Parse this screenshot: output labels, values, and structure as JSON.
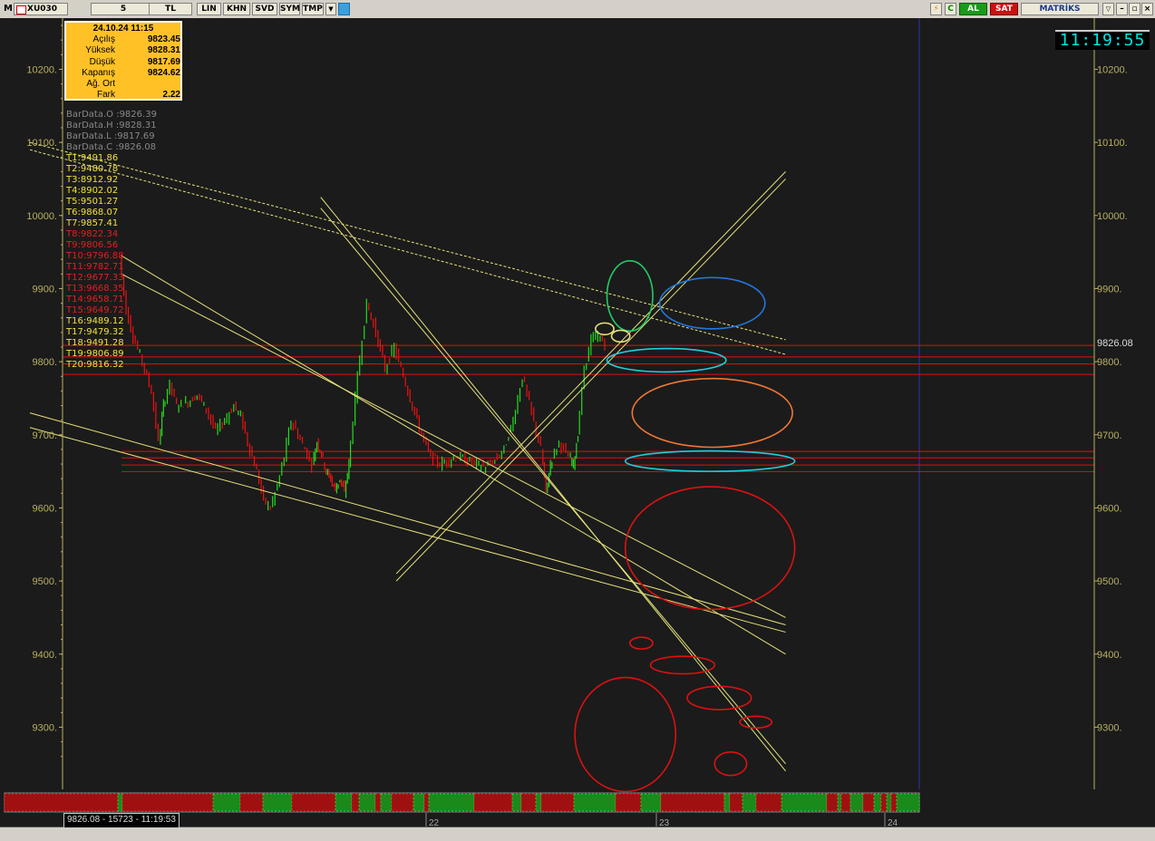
{
  "toolbar": {
    "logo": "M",
    "symbol": "XU030",
    "period": "5",
    "currency": "TL",
    "buttons": [
      "LIN",
      "KHN",
      "SVD",
      "SYM",
      "TMP"
    ],
    "buy_label": "AL",
    "sell_label": "SAT",
    "brand": "MATRİKS"
  },
  "info_box": {
    "datetime": "24.10.24 11:15",
    "rows": [
      {
        "label": "Açılış",
        "value": "9823.45"
      },
      {
        "label": "Yüksek",
        "value": "9828.31"
      },
      {
        "label": "Düşük",
        "value": "9817.69"
      },
      {
        "label": "Kapanış",
        "value": "9824.62"
      },
      {
        "label": "Ağ. Ort",
        "value": ""
      },
      {
        "label": "Fark",
        "value": "2.22"
      }
    ]
  },
  "clock": "11:19:55",
  "bar_data": [
    "BarData.O :9826.39",
    "BarData.H :9828.31",
    "BarData.L :9817.69",
    "BarData.C :9826.08"
  ],
  "t_levels": [
    {
      "text": "T1:9491.86",
      "color": "yellow"
    },
    {
      "text": "T2:9480.78",
      "color": "yellow"
    },
    {
      "text": "T3:8912.92",
      "color": "yellow"
    },
    {
      "text": "T4:8902.02",
      "color": "yellow"
    },
    {
      "text": "T5:9501.27",
      "color": "yellow"
    },
    {
      "text": "T6:9868.07",
      "color": "yellow"
    },
    {
      "text": "T7:9857.41",
      "color": "yellow"
    },
    {
      "text": "T8:9822.34",
      "color": "red"
    },
    {
      "text": "T9:9806.56",
      "color": "red"
    },
    {
      "text": "T10:9796.88",
      "color": "red"
    },
    {
      "text": "T11:9782.71",
      "color": "red"
    },
    {
      "text": "T12:9677.33",
      "color": "red"
    },
    {
      "text": "T13:9668.35",
      "color": "red"
    },
    {
      "text": "T14:9658.71",
      "color": "red"
    },
    {
      "text": "T15:9649.72",
      "color": "red"
    },
    {
      "text": "T16:9489.12",
      "color": "yellow"
    },
    {
      "text": "T17:9479.32",
      "color": "yellow"
    },
    {
      "text": "T18:9491.28",
      "color": "yellow"
    },
    {
      "text": "T19:9806.89",
      "color": "yellow"
    },
    {
      "text": "T20:9816.32",
      "color": "yellow"
    }
  ],
  "status_text": "9826.08 - 15723 - 11:19:53",
  "colors": {
    "up": "#22dd22",
    "down": "#ee1111",
    "trend": "#e6e27a",
    "level": "#e01010",
    "axis": "#b8b060",
    "bg": "#1b1b1b"
  },
  "chart_data": {
    "type": "candlestick",
    "symbol": "XU030",
    "interval": "5",
    "y_ticks": [
      "10200.",
      "10100.",
      "10000.",
      "9900.",
      "9800.",
      "9700.",
      "9600.",
      "9500.",
      "9400.",
      "9300."
    ],
    "ylim": [
      9215,
      10270
    ],
    "x_ticks": [
      "22",
      "23",
      "24"
    ],
    "last_price_label": "9826.08",
    "horizontal_levels": [
      9822.34,
      9806.56,
      9796.88,
      9782.71,
      9677.33,
      9668.35,
      9658.71,
      9649.72
    ],
    "price_path": [
      [
        0,
        9945
      ],
      [
        0.03,
        9870
      ],
      [
        0.06,
        9835
      ],
      [
        0.1,
        9800
      ],
      [
        0.14,
        9760
      ],
      [
        0.17,
        9690
      ],
      [
        0.19,
        9740
      ],
      [
        0.22,
        9770
      ],
      [
        0.25,
        9740
      ],
      [
        0.3,
        9745
      ],
      [
        0.34,
        9755
      ],
      [
        0.38,
        9735
      ],
      [
        0.42,
        9705
      ],
      [
        0.46,
        9720
      ],
      [
        0.5,
        9740
      ],
      [
        0.53,
        9725
      ],
      [
        0.56,
        9690
      ],
      [
        0.6,
        9650
      ],
      [
        0.63,
        9610
      ],
      [
        0.66,
        9600
      ],
      [
        0.69,
        9630
      ],
      [
        0.72,
        9670
      ],
      [
        0.75,
        9720
      ],
      [
        0.78,
        9700
      ],
      [
        0.81,
        9680
      ],
      [
        0.84,
        9660
      ],
      [
        0.86,
        9690
      ],
      [
        0.88,
        9675
      ],
      [
        0.9,
        9650
      ],
      [
        0.92,
        9640
      ],
      [
        0.94,
        9625
      ],
      [
        0.96,
        9640
      ],
      [
        0.98,
        9620
      ],
      [
        1.0,
        9660
      ],
      [
        1.04,
        9780
      ],
      [
        1.08,
        9880
      ],
      [
        1.12,
        9840
      ],
      [
        1.16,
        9790
      ],
      [
        1.2,
        9820
      ],
      [
        1.24,
        9780
      ],
      [
        1.28,
        9740
      ],
      [
        1.32,
        9700
      ],
      [
        1.36,
        9670
      ],
      [
        1.4,
        9660
      ],
      [
        1.44,
        9665
      ],
      [
        1.48,
        9670
      ],
      [
        1.52,
        9665
      ],
      [
        1.56,
        9660
      ],
      [
        1.6,
        9655
      ],
      [
        1.64,
        9665
      ],
      [
        1.68,
        9680
      ],
      [
        1.72,
        9720
      ],
      [
        1.76,
        9780
      ],
      [
        1.8,
        9730
      ],
      [
        1.84,
        9680
      ],
      [
        1.86,
        9620
      ],
      [
        1.88,
        9660
      ],
      [
        1.92,
        9690
      ],
      [
        1.96,
        9670
      ],
      [
        1.98,
        9660
      ],
      [
        2.0,
        9700
      ],
      [
        2.03,
        9790
      ],
      [
        2.06,
        9830
      ],
      [
        2.09,
        9835
      ],
      [
        2.12,
        9826
      ]
    ],
    "trend_lines": [
      [
        [
          0,
          9945
        ],
        [
          2.9,
          9400
        ]
      ],
      [
        [
          0,
          9920
        ],
        [
          2.9,
          9450
        ]
      ],
      [
        [
          -0.4,
          9730
        ],
        [
          2.9,
          9440
        ]
      ],
      [
        [
          -0.4,
          9710
        ],
        [
          2.9,
          9430
        ]
      ],
      [
        [
          0.87,
          10025
        ],
        [
          2.9,
          9240
        ]
      ],
      [
        [
          0.87,
          10010
        ],
        [
          2.9,
          9250
        ]
      ],
      [
        [
          1.2,
          9510
        ],
        [
          2.9,
          10060
        ]
      ],
      [
        [
          1.2,
          9500
        ],
        [
          2.9,
          10050
        ]
      ]
    ],
    "dashed_trend_lines": [
      [
        [
          -0.4,
          10100
        ],
        [
          2.9,
          9830
        ]
      ],
      [
        [
          -0.4,
          10090
        ],
        [
          2.9,
          9810
        ]
      ]
    ],
    "ellipses": [
      {
        "color": "#22cc66",
        "cx": 2.22,
        "cy": 9890,
        "rx": 0.1,
        "ry": 48
      },
      {
        "color": "#2277dd",
        "cx": 2.58,
        "cy": 9880,
        "rx": 0.23,
        "ry": 35
      },
      {
        "color": "#e6e27a",
        "cx": 2.11,
        "cy": 9845,
        "rx": 0.04,
        "ry": 8
      },
      {
        "color": "#e6e27a",
        "cx": 2.18,
        "cy": 9835,
        "rx": 0.04,
        "ry": 8
      },
      {
        "color": "#22ccdd",
        "cx": 2.38,
        "cy": 9802,
        "rx": 0.26,
        "ry": 16
      },
      {
        "color": "#ee7733",
        "cx": 2.58,
        "cy": 9730,
        "rx": 0.35,
        "ry": 47
      },
      {
        "color": "#22ccdd",
        "cx": 2.57,
        "cy": 9664,
        "rx": 0.37,
        "ry": 14
      },
      {
        "color": "#dd1111",
        "cx": 2.57,
        "cy": 9545,
        "rx": 0.37,
        "ry": 84
      },
      {
        "color": "#dd1111",
        "cx": 2.27,
        "cy": 9415,
        "rx": 0.05,
        "ry": 8
      },
      {
        "color": "#dd1111",
        "cx": 2.45,
        "cy": 9385,
        "rx": 0.14,
        "ry": 12
      },
      {
        "color": "#dd1111",
        "cx": 2.61,
        "cy": 9340,
        "rx": 0.14,
        "ry": 16
      },
      {
        "color": "#dd1111",
        "cx": 2.77,
        "cy": 9307,
        "rx": 0.07,
        "ry": 8
      },
      {
        "color": "#dd1111",
        "cx": 2.2,
        "cy": 9290,
        "rx": 0.22,
        "ry": 78
      },
      {
        "color": "#dd1111",
        "cx": 2.66,
        "cy": 9250,
        "rx": 0.07,
        "ry": 16
      }
    ]
  }
}
